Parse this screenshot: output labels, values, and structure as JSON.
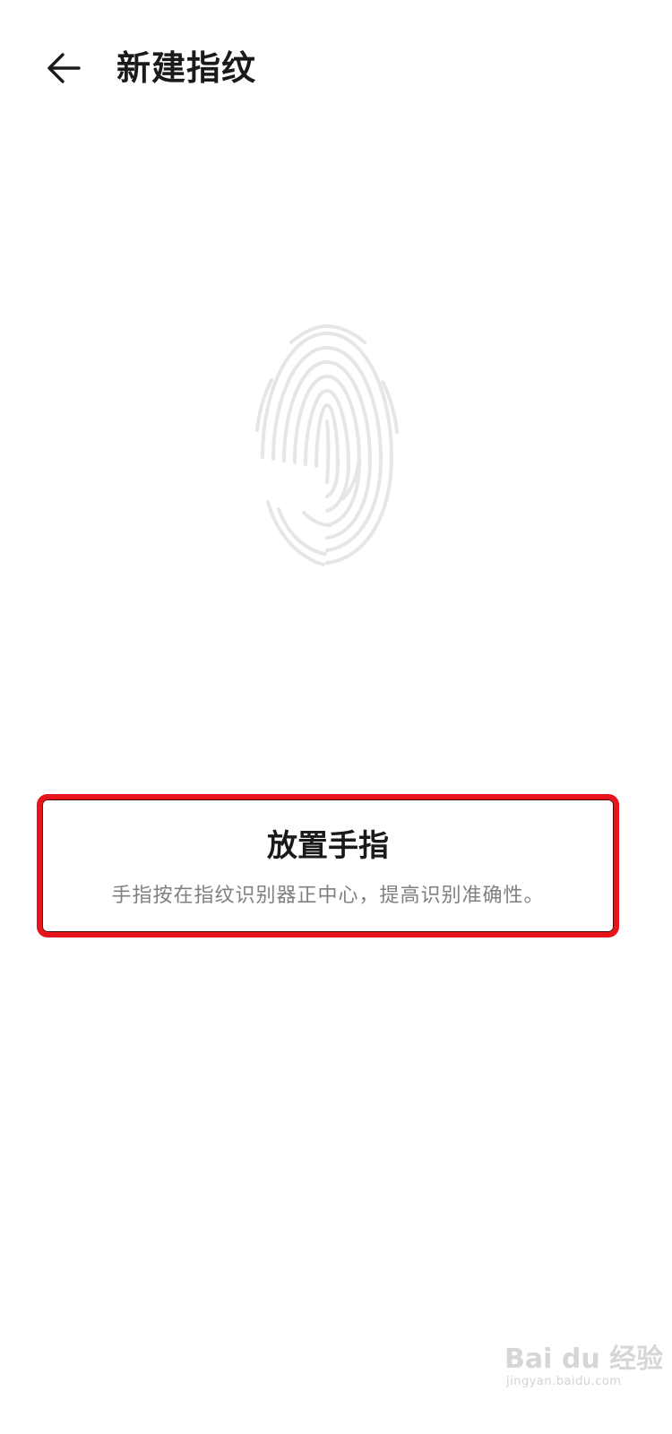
{
  "header": {
    "back_icon": "arrow-left-icon",
    "title": "新建指纹"
  },
  "fingerprint": {
    "icon": "fingerprint-icon",
    "color": "#e6e6e6"
  },
  "instruction": {
    "title": "放置手指",
    "subtitle": "手指按在指纹识别器正中心，提高识别准确性。",
    "highlight_color": "#e8141b"
  },
  "watermark": {
    "brand": "Bai du 经验",
    "url": "jingyan.baidu.com"
  }
}
